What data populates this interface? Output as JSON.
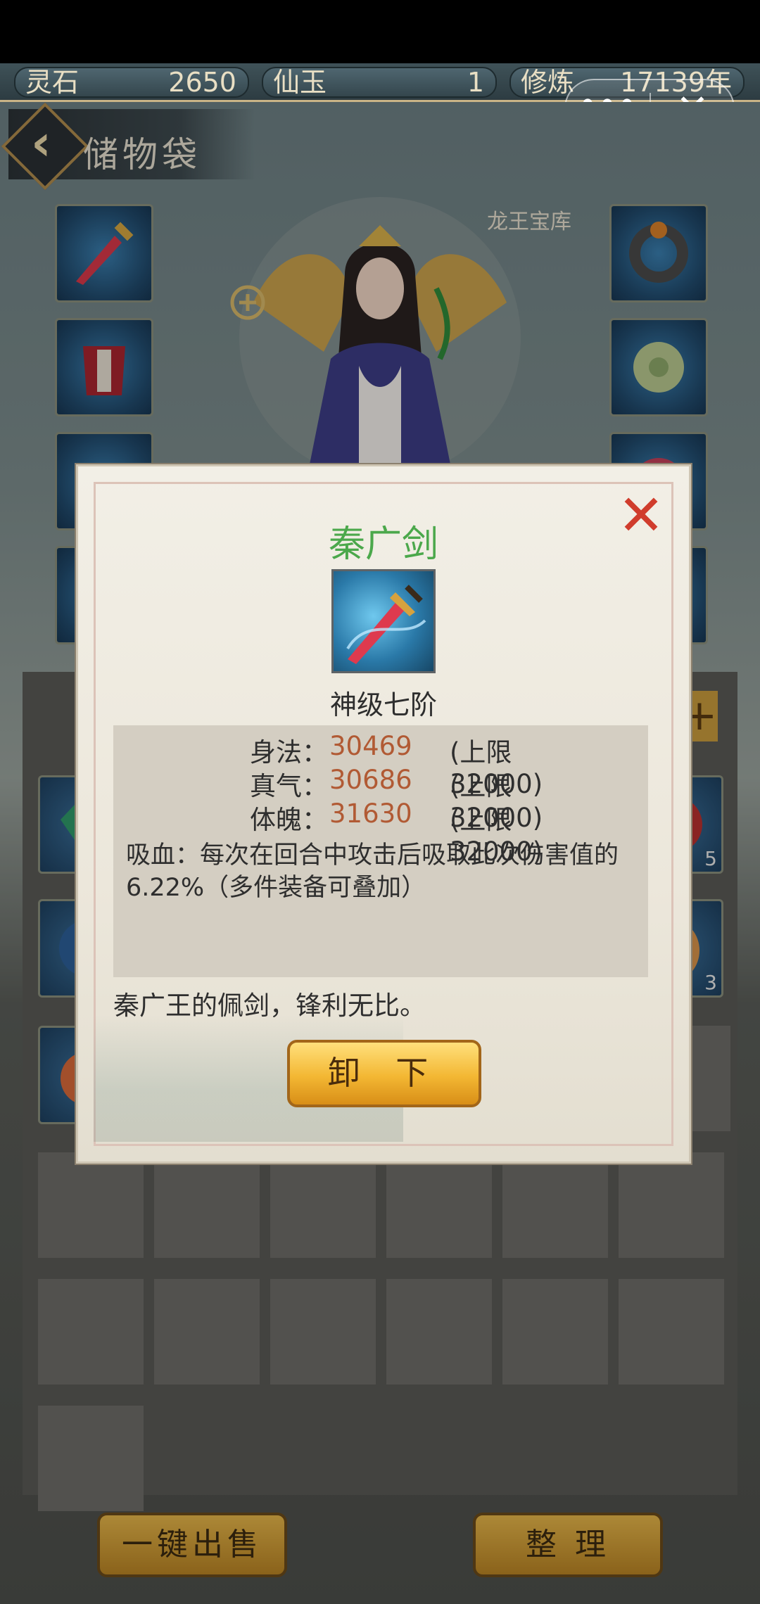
{
  "resources": [
    {
      "label": "灵石",
      "value": "2650"
    },
    {
      "label": "仙玉",
      "value": "1"
    },
    {
      "label": "修炼",
      "value": "17139年"
    }
  ],
  "capsule": {
    "more": "•••",
    "close": "✕"
  },
  "bag": {
    "title": "储物袋"
  },
  "treasury_badge": "龙王宝库",
  "left_slots": [
    "sword-icon",
    "armor-icon",
    "helmet-icon",
    "boots-icon"
  ],
  "right_slots": [
    "ring-icon",
    "jade-icon",
    "orb-icon",
    "charm-icon"
  ],
  "side_counts": {
    "row1": "5",
    "row2": "3"
  },
  "bottom_buttons": {
    "sell_all": "一键出售",
    "sort": "整 理"
  },
  "modal": {
    "item_name": "秦广剑",
    "grade": "神级七阶",
    "stats": [
      {
        "name": "身法：",
        "value": "30469",
        "limit": "(上限32000)"
      },
      {
        "name": "真气：",
        "value": "30686",
        "limit": "(上限32000)"
      },
      {
        "name": "体魄：",
        "value": "31630",
        "limit": "(上限32000)"
      }
    ],
    "effect": "吸血：每次在回合中攻击后吸取此次伤害值的6.22%（多件装备可叠加）",
    "description": "秦广王的佩剑，锋利无比。",
    "unequip_label": "卸 下",
    "close_icon": "✕"
  }
}
